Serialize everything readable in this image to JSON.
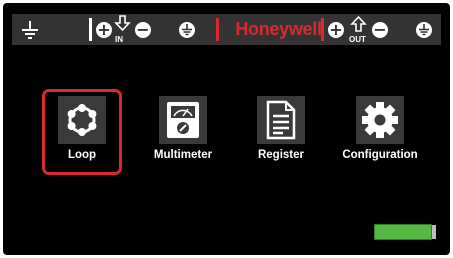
{
  "brand": "Honeywell",
  "toolbar": {
    "ground_icon": "ground-icon",
    "in_label": "IN",
    "out_label": "OUT",
    "plus_glyph": "+",
    "minus_glyph": "−"
  },
  "apps": [
    {
      "label": "Loop",
      "icon": "loop-icon",
      "selected": true
    },
    {
      "label": "Multimeter",
      "icon": "multimeter-icon",
      "selected": false
    },
    {
      "label": "Register",
      "icon": "register-icon",
      "selected": false
    },
    {
      "label": "Configuration",
      "icon": "gear-icon",
      "selected": false
    }
  ],
  "battery": {
    "level": 1.0,
    "color": "#55b844"
  },
  "colors": {
    "accent": "#d72a2f",
    "background": "#000000",
    "bar": "#333333"
  }
}
